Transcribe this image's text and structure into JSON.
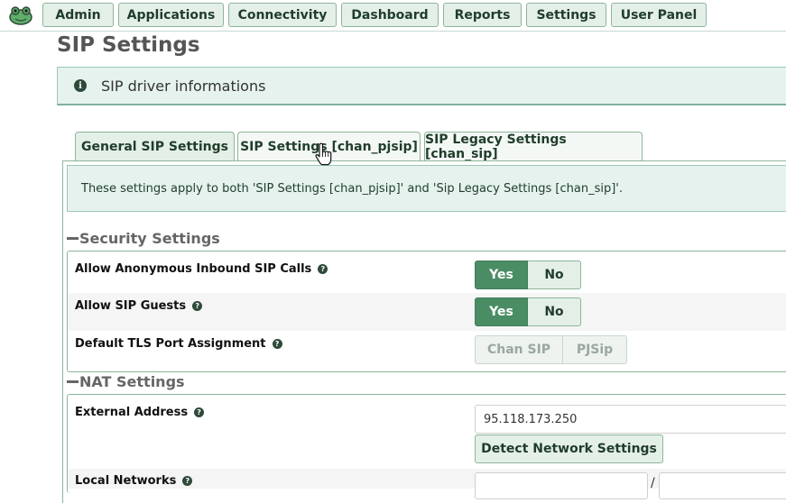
{
  "nav": {
    "items": [
      "Admin",
      "Applications",
      "Connectivity",
      "Dashboard",
      "Reports",
      "Settings",
      "User Panel"
    ]
  },
  "page": {
    "title": "SIP Settings"
  },
  "info_bar": {
    "icon": "info-circle-icon",
    "text": "SIP driver informations"
  },
  "tabs": [
    {
      "label": "General SIP Settings",
      "active": true
    },
    {
      "label": "SIP Settings [chan_pjsip]",
      "active": false
    },
    {
      "label": "SIP Legacy Settings [chan_sip]",
      "active": false
    }
  ],
  "note": {
    "text": "These settings apply to both 'SIP Settings [chan_pjsip]' and 'Sip Legacy Settings [chan_sip]'."
  },
  "security": {
    "title": "Security Settings",
    "anonymous": {
      "label": "Allow Anonymous Inbound SIP Calls",
      "yes": "Yes",
      "no": "No",
      "selected": "Yes"
    },
    "guests": {
      "label": "Allow SIP Guests",
      "yes": "Yes",
      "no": "No",
      "selected": "Yes"
    },
    "tls": {
      "label": "Default TLS Port Assignment",
      "opt1": "Chan SIP",
      "opt2": "PJSip"
    }
  },
  "nat": {
    "title": "NAT Settings",
    "external": {
      "label": "External Address",
      "value": "95.118.173.250",
      "detect_label": "Detect Network Settings"
    },
    "local_networks": {
      "label": "Local Networks",
      "separator": "/"
    }
  },
  "colors": {
    "accent": "#4a8d65",
    "light": "#e4efe8",
    "border": "#8db59a"
  }
}
